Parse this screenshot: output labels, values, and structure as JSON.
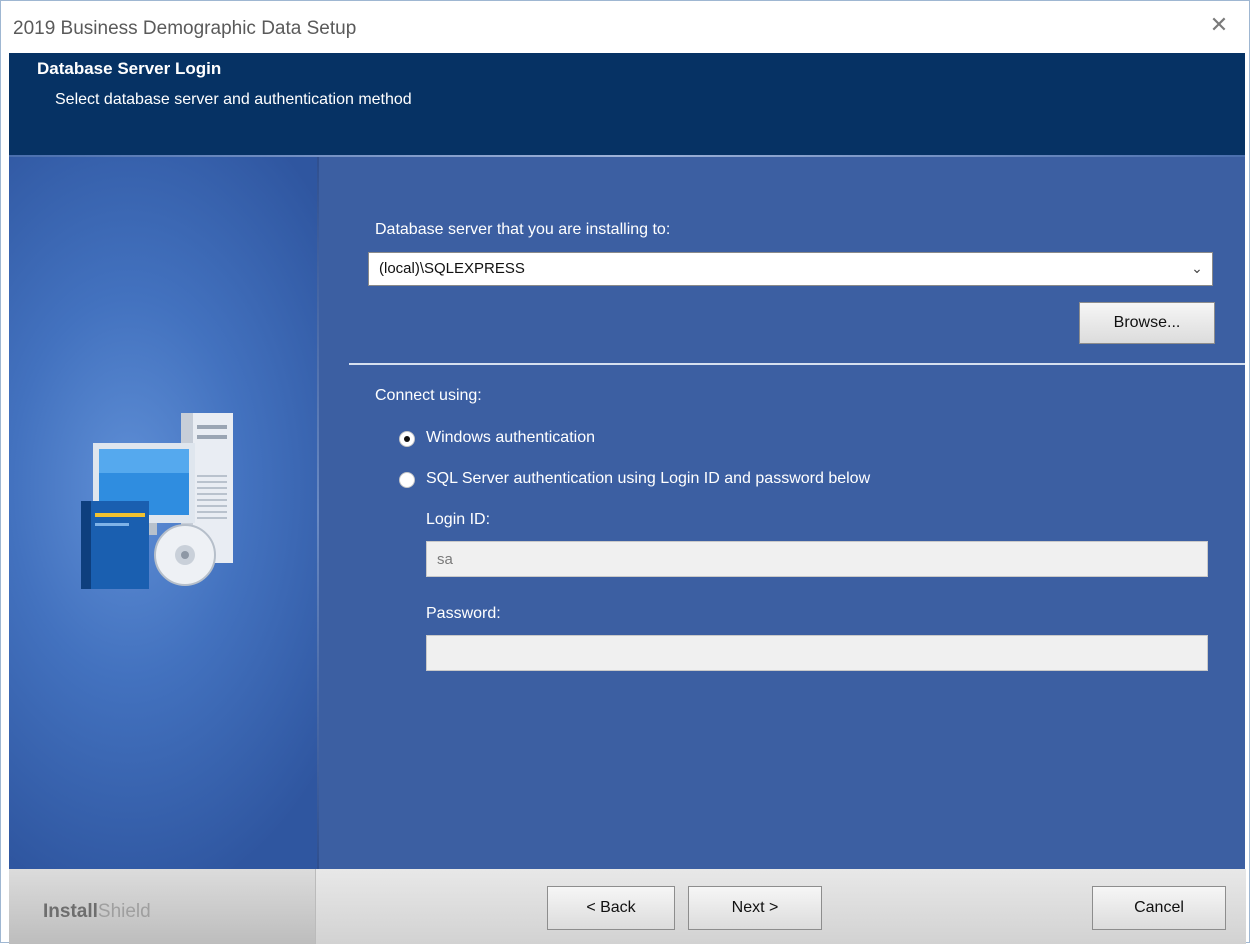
{
  "window": {
    "title": "2019 Business Demographic Data Setup",
    "close_glyph": "✕"
  },
  "header": {
    "title": "Database Server Login",
    "subtitle": "Select database server and authentication method"
  },
  "server": {
    "label": "Database server that you are installing to:",
    "value": "(local)\\SQLEXPRESS",
    "browse_label": "Browse..."
  },
  "connect": {
    "label": "Connect using:",
    "options": [
      {
        "label": "Windows authentication",
        "selected": true
      },
      {
        "label": "SQL Server authentication using Login ID and password below",
        "selected": false
      }
    ],
    "login_id_label": "Login ID:",
    "login_id_value": "sa",
    "password_label": "Password:",
    "password_value": ""
  },
  "footer": {
    "brand_part1": "Install",
    "brand_part2": "Shield",
    "back_label": "< Back",
    "next_label": "Next >",
    "cancel_label": "Cancel"
  },
  "icons": {
    "illustration": "computer-with-disc-icon",
    "close": "close-icon",
    "combo_arrow": "chevron-down-icon"
  }
}
